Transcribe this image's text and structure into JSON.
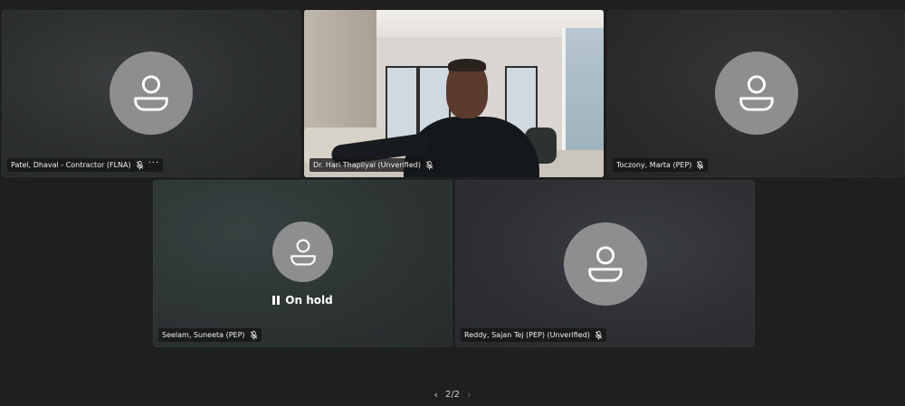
{
  "tiles": [
    {
      "name": "Patel, Dhaval - Contractor (FLNA)",
      "muted": true,
      "has_more": true,
      "more_label": "···",
      "video": false
    },
    {
      "name": "Dr. Hari Thapliyal (Unverified)",
      "muted": true,
      "video": true
    },
    {
      "name": "Toczony, Marta (PEP)",
      "muted": true,
      "video": false
    },
    {
      "name": "Seelam, Suneeta (PEP)",
      "muted": true,
      "video": false,
      "status": "On hold"
    },
    {
      "name": "Reddy, Sajan Tej (PEP) (Unverified)",
      "muted": true,
      "video": false
    }
  ],
  "pager": {
    "label": "2/2",
    "prev_icon": "chevron-left-icon",
    "next_icon": "chevron-right-icon"
  },
  "colors": {
    "background": "#1f1f1f",
    "avatar": "#8e8e8e",
    "nameplate": "#141414"
  }
}
